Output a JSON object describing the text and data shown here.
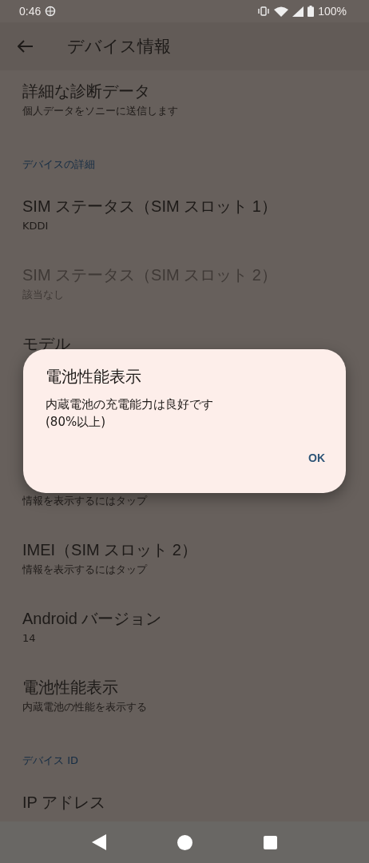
{
  "status_bar": {
    "time": "0:46",
    "battery": "100%"
  },
  "app_bar": {
    "title": "デバイス情報"
  },
  "list": [
    {
      "kind": "row",
      "title": "詳細な診断データ",
      "subtitle": "個人データをソニーに送信します",
      "disabled": false
    },
    {
      "kind": "header",
      "title": "デバイスの詳細"
    },
    {
      "kind": "row",
      "title": "SIM ステータス（SIM スロット 1）",
      "subtitle": "KDDI",
      "disabled": false
    },
    {
      "kind": "row",
      "title": "SIM ステータス（SIM スロット 2）",
      "subtitle": "該当なし",
      "disabled": true
    },
    {
      "kind": "row",
      "title": "モデル",
      "disabled": false
    },
    {
      "kind": "row",
      "subtitle": "情報を表示するにはタップ",
      "disabled": false
    },
    {
      "kind": "row",
      "title": "IMEI（SIM スロット 2）",
      "subtitle": "情報を表示するにはタップ",
      "disabled": false
    },
    {
      "kind": "row",
      "title": "Android バージョン",
      "subtitle": "14",
      "disabled": false
    },
    {
      "kind": "row",
      "title": "電池性能表示",
      "subtitle": "内蔵電池の性能を表示する",
      "disabled": false
    },
    {
      "kind": "header",
      "title": "デバイス ID"
    },
    {
      "kind": "row",
      "title": "IP アドレス",
      "disabled": false
    }
  ],
  "dialog": {
    "title": "電池性能表示",
    "message": "内蔵電池の充電能力は良好です\n(80%以上)",
    "buttons": [
      "OK"
    ]
  }
}
